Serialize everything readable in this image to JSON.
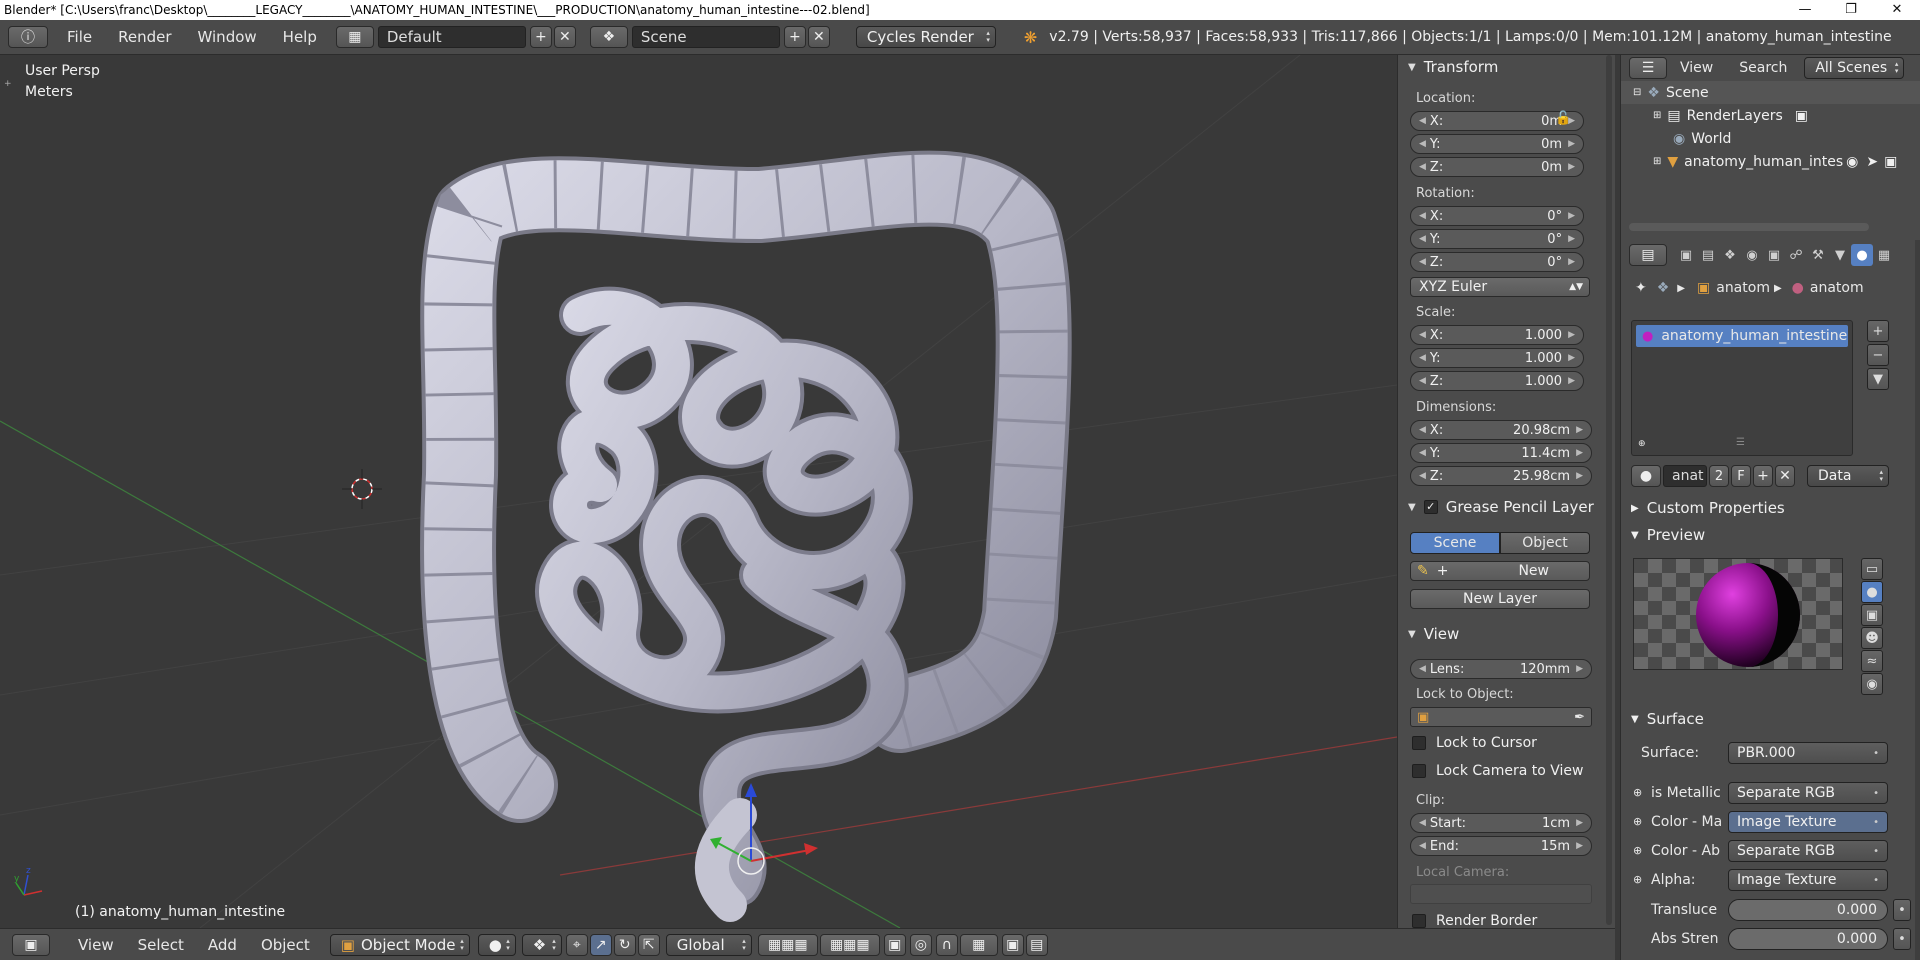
{
  "window": {
    "title": "Blender* [C:\\Users\\franc\\Desktop\\________LEGACY________\\ANATOMY_HUMAN_INTESTINE\\___PRODUCTION\\anatomy_human_intestine---02.blend]",
    "minimize": "—",
    "maximize": "❐",
    "close": "✕"
  },
  "infobar": {
    "menus": [
      "File",
      "Render",
      "Window",
      "Help"
    ],
    "layout": "Default",
    "scene": "Scene",
    "engine": "Cycles Render",
    "stats": "v2.79 | Verts:58,937 | Faces:58,933 | Tris:117,866 | Objects:1/1 | Lamps:0/0 | Mem:101.12M | anatomy_human_intestine"
  },
  "viewport": {
    "view_name": "User Persp",
    "units": "Meters",
    "object_label": "(1) anatomy_human_intestine"
  },
  "bottombar": {
    "menus": [
      "View",
      "Select",
      "Add",
      "Object"
    ],
    "mode": "Object Mode",
    "orientation": "Global"
  },
  "npanel": {
    "transform": {
      "title": "Transform",
      "location_label": "Location:",
      "location": [
        {
          "axis": "X:",
          "value": "0m"
        },
        {
          "axis": "Y:",
          "value": "0m"
        },
        {
          "axis": "Z:",
          "value": "0m"
        }
      ],
      "rotation_label": "Rotation:",
      "rotation": [
        {
          "axis": "X:",
          "value": "0°"
        },
        {
          "axis": "Y:",
          "value": "0°"
        },
        {
          "axis": "Z:",
          "value": "0°"
        }
      ],
      "rotation_mode": "XYZ Euler",
      "scale_label": "Scale:",
      "scale": [
        {
          "axis": "X:",
          "value": "1.000"
        },
        {
          "axis": "Y:",
          "value": "1.000"
        },
        {
          "axis": "Z:",
          "value": "1.000"
        }
      ],
      "dimensions_label": "Dimensions:",
      "dimensions": [
        {
          "axis": "X:",
          "value": "20.98cm"
        },
        {
          "axis": "Y:",
          "value": "11.4cm"
        },
        {
          "axis": "Z:",
          "value": "25.98cm"
        }
      ]
    },
    "grease": {
      "title": "Grease Pencil Layer",
      "tab_scene": "Scene",
      "tab_object": "Object",
      "new": "New",
      "new_layer": "New Layer"
    },
    "view": {
      "title": "View",
      "lens": "Lens:",
      "lens_value": "120mm",
      "lock_to_object": "Lock to Object:",
      "lock_to_cursor": "Lock to Cursor",
      "lock_camera": "Lock Camera to View",
      "clip": "Clip:",
      "start": "Start:",
      "start_value": "1cm",
      "end": "End:",
      "end_value": "15m",
      "local_camera": "Local Camera:",
      "render_border": "Render Border"
    }
  },
  "outliner": {
    "menus": [
      "View",
      "Search"
    ],
    "filter": "All Scenes",
    "items": [
      "Scene",
      "RenderLayers",
      "World",
      "anatomy_human_intes"
    ]
  },
  "props": {
    "breadcrumb": [
      "anatom",
      "anatom"
    ],
    "material_slot": "anatomy_human_intestine",
    "mat_short": "anat",
    "users": "2",
    "fake": "F",
    "link": "Data",
    "custom_properties": "Custom Properties",
    "preview": "Preview",
    "surface_title": "Surface",
    "surface_label": "Surface:",
    "surface_value": "PBR.000",
    "inputs": [
      {
        "label": "is Metallic",
        "value": "Separate RGB",
        "hl": false
      },
      {
        "label": "Color - Ma",
        "value": "Image Texture",
        "hl": true
      },
      {
        "label": "Color - Ab",
        "value": "Separate RGB",
        "hl": false
      },
      {
        "label": "Alpha:",
        "value": "Image Texture",
        "hl": false
      }
    ],
    "sliders": [
      {
        "label": "Transluce",
        "value": "0.000"
      },
      {
        "label": "Abs Stren",
        "value": "0.000"
      }
    ]
  }
}
